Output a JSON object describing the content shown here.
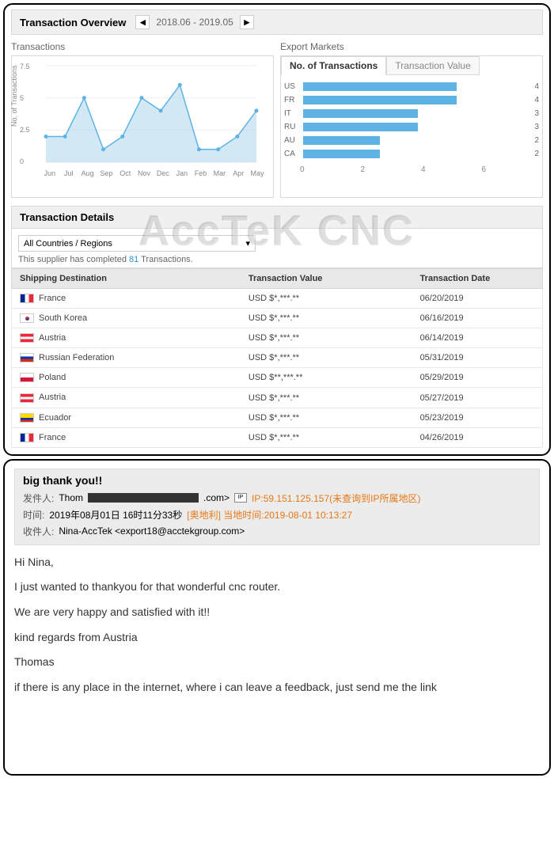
{
  "overview": {
    "title": "Transaction Overview",
    "date_range": "2018.06 - 2019.05"
  },
  "watermark": "AccTeK CNC",
  "chart_data": [
    {
      "type": "line",
      "title": "Transactions",
      "ylabel": "No. of Transactions",
      "categories": [
        "Jun",
        "Jul",
        "Aug",
        "Sep",
        "Oct",
        "Nov",
        "Dec",
        "Jan",
        "Feb",
        "Mar",
        "Apr",
        "May"
      ],
      "values": [
        2,
        2,
        5,
        1,
        2,
        5,
        4,
        6,
        1,
        1,
        2,
        4
      ],
      "ylim": [
        0,
        7.5
      ],
      "yticks": [
        0,
        2.5,
        5,
        7.5
      ]
    },
    {
      "type": "bar",
      "title": "Export Markets",
      "tabs": [
        "No. of Transactions",
        "Transaction Value"
      ],
      "active_tab": 0,
      "categories": [
        "US",
        "FR",
        "IT",
        "RU",
        "AU",
        "CA"
      ],
      "values": [
        4,
        4,
        3,
        3,
        2,
        2
      ],
      "xlim": [
        0,
        6
      ],
      "xticks": [
        0,
        2,
        4,
        6
      ]
    }
  ],
  "details": {
    "title": "Transaction Details",
    "filter": "All Countries / Regions",
    "completion_prefix": "This supplier has completed ",
    "completion_count": "81",
    "completion_suffix": " Transactions.",
    "columns": [
      "Shipping Destination",
      "Transaction Value",
      "Transaction Date"
    ],
    "rows": [
      {
        "flag": "fr",
        "dest": "France",
        "val": "USD $*,***.**",
        "date": "06/20/2019"
      },
      {
        "flag": "kr",
        "dest": "South Korea",
        "val": "USD $*,***.**",
        "date": "06/16/2019"
      },
      {
        "flag": "at",
        "dest": "Austria",
        "val": "USD $*,***.**",
        "date": "06/14/2019"
      },
      {
        "flag": "ru",
        "dest": "Russian Federation",
        "val": "USD $*,***.**",
        "date": "05/31/2019"
      },
      {
        "flag": "pl",
        "dest": "Poland",
        "val": "USD $**,***.**",
        "date": "05/29/2019"
      },
      {
        "flag": "at",
        "dest": "Austria",
        "val": "USD $*,***.**",
        "date": "05/27/2019"
      },
      {
        "flag": "ec",
        "dest": "Ecuador",
        "val": "USD $*,***.**",
        "date": "05/23/2019"
      },
      {
        "flag": "fr",
        "dest": "France",
        "val": "USD $*,***.**",
        "date": "04/26/2019"
      }
    ]
  },
  "email": {
    "subject": "big thank you!!",
    "from_label": "发件人:",
    "from_name_prefix": "Thom",
    "from_suffix": ".com>",
    "ip_text": "IP:59.151.125.157(未查询到IP所属地区)",
    "time_label": "时间:",
    "time_value": "2019年08月01日 16时11分33秒",
    "local_time": "[奥地利] 当地时间:2019-08-01 10:13:27",
    "to_label": "收件人:",
    "to_value": "Nina-AccTek <export18@acctekgroup.com>",
    "body": [
      "Hi Nina,",
      "I just wanted to thankyou for that wonderful cnc router.",
      "We are very happy and satisfied with it!!",
      "kind regards from Austria",
      "Thomas",
      "if there is any place in the internet, where i can leave a feedback, just send me the link"
    ]
  }
}
